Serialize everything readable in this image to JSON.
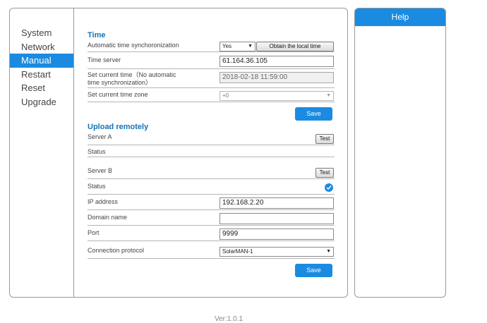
{
  "nav": {
    "items": [
      {
        "label": "System"
      },
      {
        "label": "Network"
      },
      {
        "label": "Manual"
      },
      {
        "label": "Restart"
      },
      {
        "label": "Reset"
      },
      {
        "label": "Upgrade"
      }
    ],
    "active": "Manual"
  },
  "time": {
    "title": "Time",
    "auto_sync_label": "Automatic time synchoronization",
    "auto_sync_value": "Yes",
    "obtain_local_button": "Obtain the local time",
    "time_server_label": "Time server",
    "time_server_value": "61.164.36.105",
    "set_time_label_line1": "Set current time（No automatic",
    "set_time_label_line2": "time synchronization）",
    "set_time_value": "2018-02-18 11:59:00",
    "timezone_label": "Set current time zone",
    "timezone_value": "+0",
    "save_button": "Save"
  },
  "upload": {
    "title": "Upload remotely",
    "server_a_label": "Server A",
    "server_a_test_button": "Test",
    "server_a_status_label": "Status",
    "server_b_label": "Server B",
    "server_b_test_button": "Test",
    "server_b_status_label": "Status",
    "server_b_status_checked": true,
    "ip_label": "IP address",
    "ip_value": "192.168.2.20",
    "domain_label": "Domain name",
    "domain_value": "",
    "port_label": "Port",
    "port_value": "9999",
    "protocol_label": "Connection protocol",
    "protocol_value": "SolarMAN-1",
    "save_button": "Save"
  },
  "help": {
    "title": "Help"
  },
  "footer": {
    "version": "Ver:1.0.1"
  },
  "colors": {
    "accent": "#1a8be0",
    "section_title": "#1373b5"
  },
  "icons": {
    "status_check": "check-circle-icon",
    "select_arrow": "caret-down-icon"
  }
}
